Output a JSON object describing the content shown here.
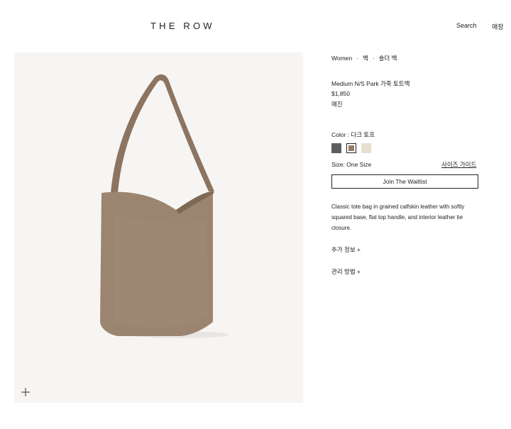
{
  "header": {
    "logo": "THE ROW",
    "search_label": "Search",
    "store_label": "매장"
  },
  "breadcrumb": {
    "items": [
      "Women",
      "백",
      "숄더 백"
    ],
    "separator": "·"
  },
  "product": {
    "name": "Medium N/S Park 가죽 토트백",
    "price": "$1,850",
    "availability": "매진",
    "color_label": "Color : 다크 토프",
    "swatches": [
      {
        "name": "dark-gray",
        "color": "#5e5e5e"
      },
      {
        "name": "dark-taupe",
        "color": "#9a7c65",
        "selected": true
      },
      {
        "name": "ivory",
        "color": "#e6e0cf"
      }
    ],
    "size_label": "Size: One Size",
    "size_guide_label": "사이즈 가이드",
    "waitlist_label": "Join The Waitlist",
    "description": "Classic tote bag in grained calfskin leather with softly squared base, flat top handle, and interior leather tie closure.",
    "more_info_label": "추가 정보 +",
    "care_label": "관리 방법 +"
  },
  "image": {
    "zoom_icon": "plus-icon",
    "bag_color": "#9c8570"
  }
}
